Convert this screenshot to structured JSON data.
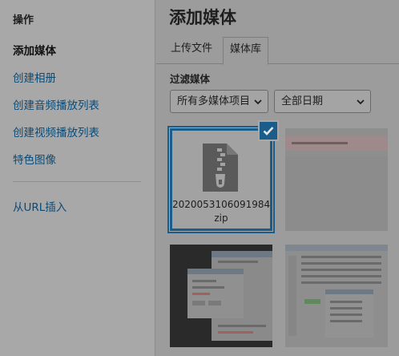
{
  "sidebar": {
    "heading": "操作",
    "items": [
      {
        "label": "添加媒体"
      },
      {
        "label": "创建相册"
      },
      {
        "label": "创建音频播放列表"
      },
      {
        "label": "创建视频播放列表"
      },
      {
        "label": "特色图像"
      }
    ],
    "url_insert": "从URL插入"
  },
  "main": {
    "title": "添加媒体",
    "tabs": [
      {
        "label": "上传文件"
      },
      {
        "label": "媒体库"
      }
    ],
    "filter_label": "过滤媒体",
    "filter_type": "所有多媒体项目",
    "filter_date": "全部日期"
  },
  "attachments": [
    {
      "filename_line1": "2020053106091984.",
      "filename_line2": "zip",
      "icon": "zip-file-icon",
      "selected": true
    },
    {
      "icon": "screenshot-thumbnail"
    },
    {
      "icon": "screenshot-thumbnail"
    },
    {
      "icon": "screenshot-thumbnail"
    }
  ],
  "colors": {
    "accent": "#1a5c8a",
    "link": "#0a4b78",
    "overlay_bg": "#9c9c9c"
  }
}
